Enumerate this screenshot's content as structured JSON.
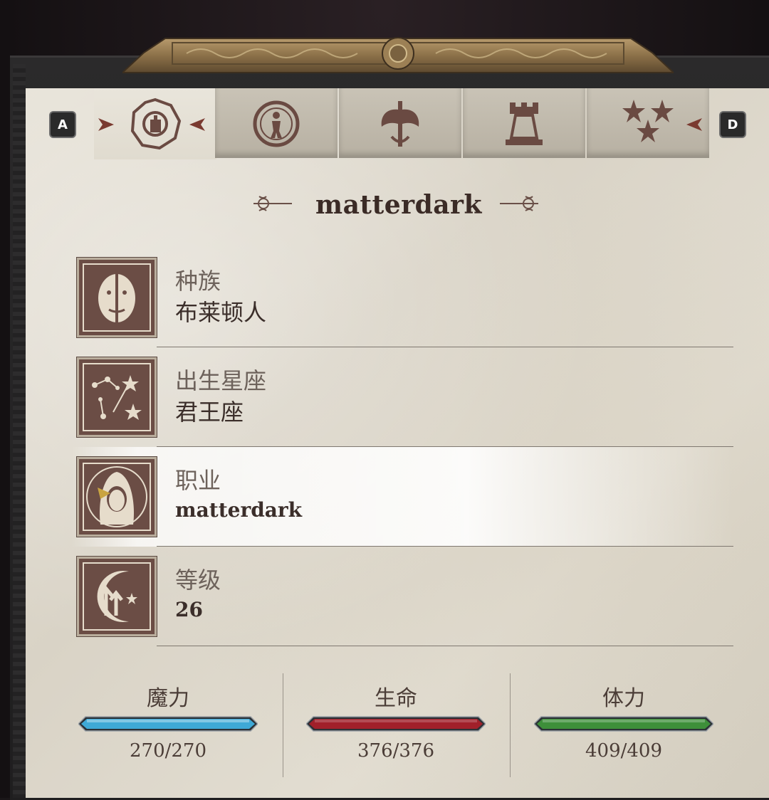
{
  "nav": {
    "prev_key": "A",
    "next_key": "D"
  },
  "character": {
    "name": "matterdark"
  },
  "rows": [
    {
      "label": "种族",
      "value": "布莱顿人",
      "icon": "race-face-icon"
    },
    {
      "label": "出生星座",
      "value": "君王座",
      "icon": "constellation-icon"
    },
    {
      "label": "职业",
      "value": "matterdark",
      "icon": "hooded-figure-icon"
    },
    {
      "label": "等级",
      "value": "26",
      "icon": "level-up-moon-icon"
    }
  ],
  "stats": [
    {
      "label": "魔力",
      "value": "270/270",
      "current": 270,
      "max": 270,
      "color": "#3fa9d6"
    },
    {
      "label": "生命",
      "value": "376/376",
      "current": 376,
      "max": 376,
      "color": "#a1202a"
    },
    {
      "label": "体力",
      "value": "409/409",
      "current": 409,
      "max": 409,
      "color": "#3e8f3a"
    }
  ],
  "tabs": [
    {
      "icon": "character-emblem-icon",
      "active": true
    },
    {
      "icon": "ouroboros-figure-icon",
      "active": false
    },
    {
      "icon": "axe-sword-icon",
      "active": false
    },
    {
      "icon": "tower-icon",
      "active": false
    },
    {
      "icon": "stars-crest-icon",
      "active": false
    }
  ]
}
